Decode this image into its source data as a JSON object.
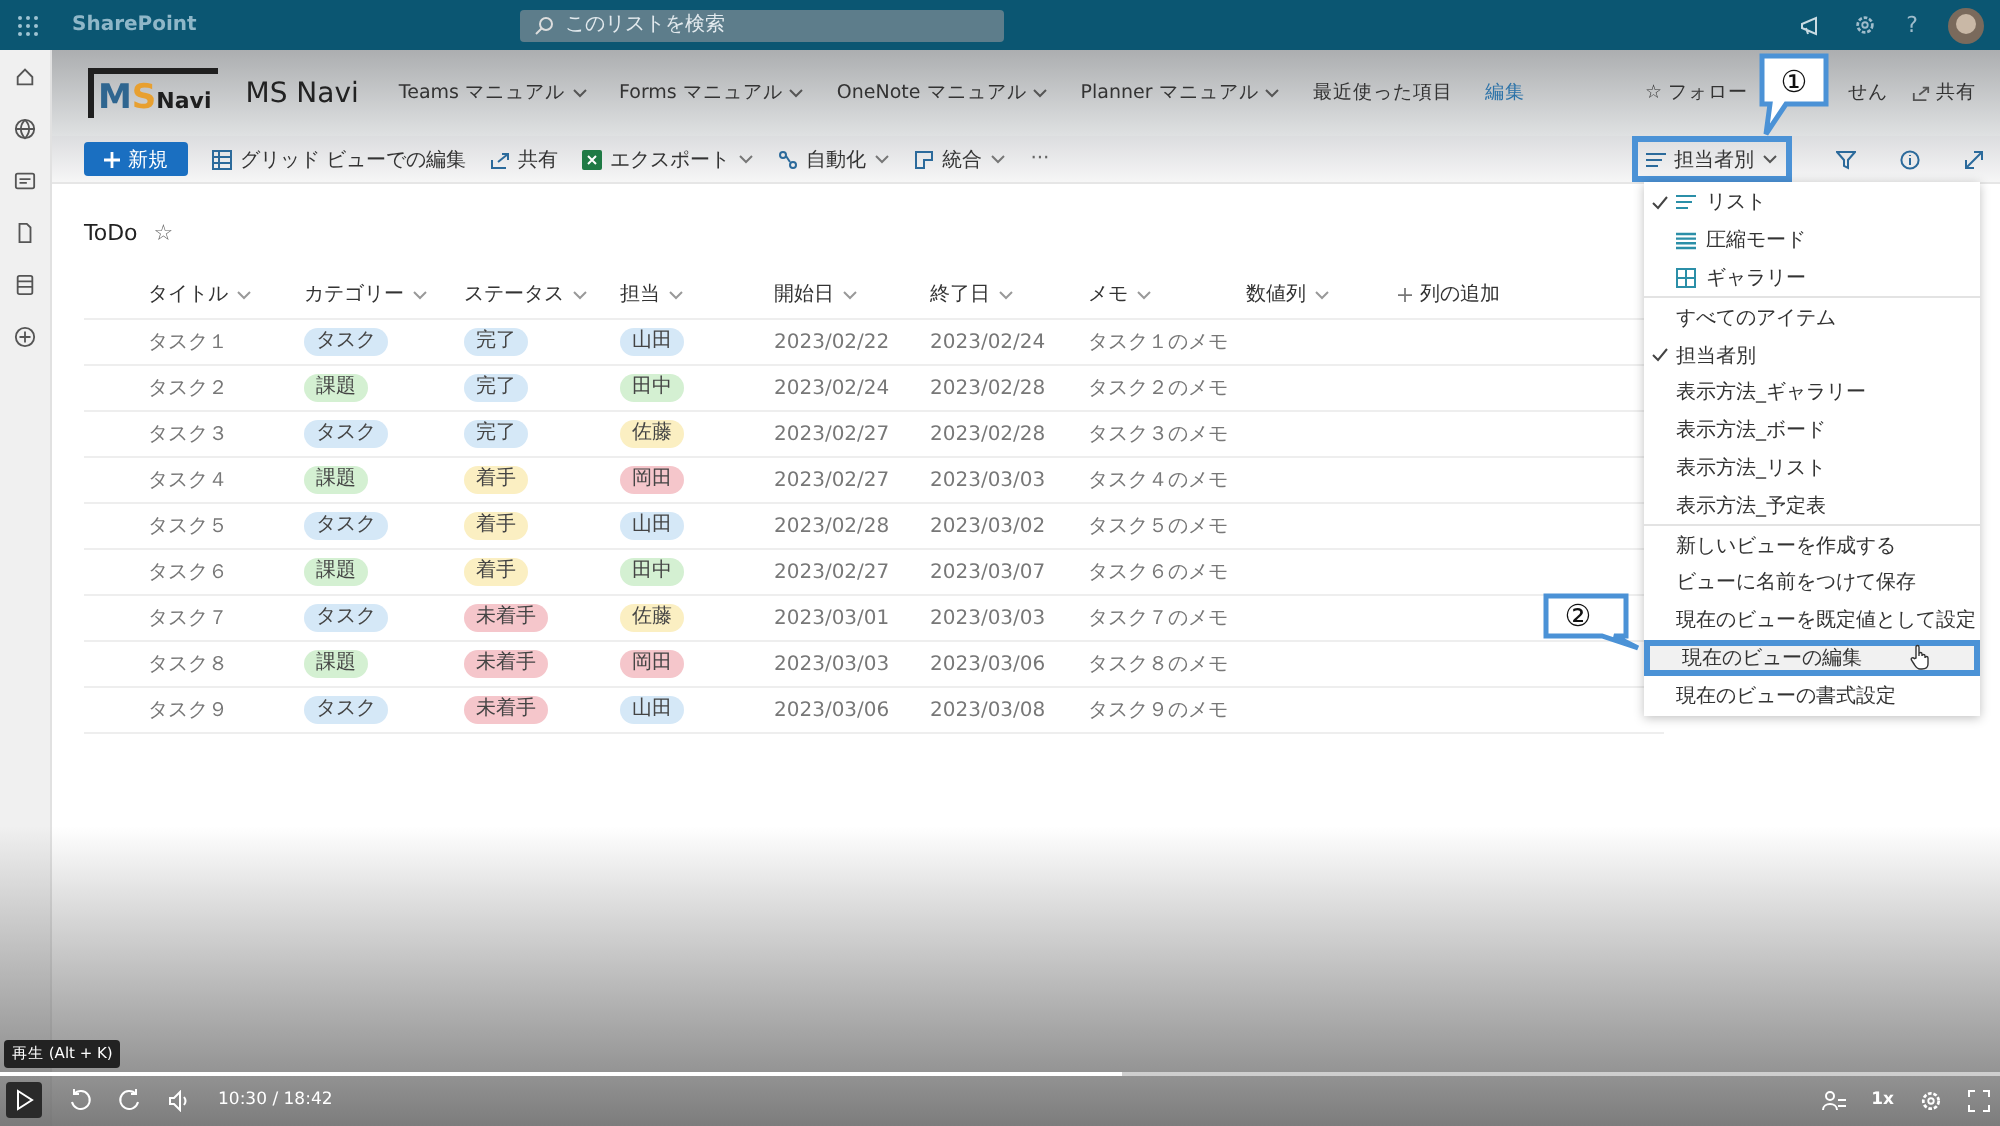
{
  "top_bar": {
    "app_name": "SharePoint",
    "search": {
      "placeholder": "このリストを検索"
    },
    "help": "?"
  },
  "site_header": {
    "logo": [
      {
        "text": "M",
        "color": "#2f6690"
      },
      {
        "text": "S",
        "color": "#e8a030"
      },
      {
        "text": "Navi",
        "color": "#1f1f1f"
      }
    ],
    "site_title": "MS Navi",
    "nav": [
      {
        "label": "Teams マニュアル",
        "kind": "menu"
      },
      {
        "label": "Forms マニュアル",
        "kind": "menu"
      },
      {
        "label": "OneNote マニュアル",
        "kind": "menu"
      },
      {
        "label": "Planner マニュアル",
        "kind": "menu"
      },
      {
        "label": "最近使った項目",
        "kind": "plain"
      },
      {
        "label": "編集",
        "kind": "link"
      }
    ],
    "follow": {
      "star": "☆",
      "before": "フォロー",
      "after": "せん"
    },
    "share": "共有"
  },
  "command_bar": {
    "new": "新規",
    "items": [
      {
        "label": "グリッド ビューでの編集",
        "kind": "grid",
        "dropdown": false
      },
      {
        "label": "共有",
        "kind": "share",
        "dropdown": false
      },
      {
        "label": "エクスポート",
        "kind": "excel",
        "dropdown": true
      },
      {
        "label": "自動化",
        "kind": "automate",
        "dropdown": true
      },
      {
        "label": "統合",
        "kind": "integrate",
        "dropdown": true
      }
    ],
    "more": "···",
    "view": "担当者別"
  },
  "list": {
    "title": "ToDo",
    "star": "☆",
    "columns": [
      {
        "label": "タイトル",
        "kind": "column"
      },
      {
        "label": "カテゴリー",
        "kind": "column"
      },
      {
        "label": "ステータス",
        "kind": "column"
      },
      {
        "label": "担当",
        "kind": "column"
      },
      {
        "label": "開始日",
        "kind": "column"
      },
      {
        "label": "終了日",
        "kind": "column"
      },
      {
        "label": "メモ",
        "kind": "column"
      },
      {
        "label": "数値列",
        "kind": "column"
      },
      {
        "label": "列の追加",
        "kind": "add"
      }
    ],
    "rows": [
      {
        "title": "タスク１",
        "category": {
          "text": "タスク",
          "color": "#d5e8f7"
        },
        "status": {
          "text": "完了",
          "color": "#d5e8f7"
        },
        "owner": {
          "text": "山田",
          "color": "#d5e8f7"
        },
        "start": "2023/02/22",
        "end": "2023/02/24",
        "memo": "タスク１のメモ"
      },
      {
        "title": "タスク２",
        "category": {
          "text": "課題",
          "color": "#d4f0d2"
        },
        "status": {
          "text": "完了",
          "color": "#d5e8f7"
        },
        "owner": {
          "text": "田中",
          "color": "#d4f0d2"
        },
        "start": "2023/02/24",
        "end": "2023/02/28",
        "memo": "タスク２のメモ"
      },
      {
        "title": "タスク３",
        "category": {
          "text": "タスク",
          "color": "#d5e8f7"
        },
        "status": {
          "text": "完了",
          "color": "#d5e8f7"
        },
        "owner": {
          "text": "佐藤",
          "color": "#fbefc2"
        },
        "start": "2023/02/27",
        "end": "2023/02/28",
        "memo": "タスク３のメモ"
      },
      {
        "title": "タスク４",
        "category": {
          "text": "課題",
          "color": "#d4f0d2"
        },
        "status": {
          "text": "着手",
          "color": "#fbefc2"
        },
        "owner": {
          "text": "岡田",
          "color": "#f5c6cb"
        },
        "start": "2023/02/27",
        "end": "2023/03/03",
        "memo": "タスク４のメモ"
      },
      {
        "title": "タスク５",
        "category": {
          "text": "タスク",
          "color": "#d5e8f7"
        },
        "status": {
          "text": "着手",
          "color": "#fbefc2"
        },
        "owner": {
          "text": "山田",
          "color": "#d5e8f7"
        },
        "start": "2023/02/28",
        "end": "2023/03/02",
        "memo": "タスク５のメモ"
      },
      {
        "title": "タスク６",
        "category": {
          "text": "課題",
          "color": "#d4f0d2"
        },
        "status": {
          "text": "着手",
          "color": "#fbefc2"
        },
        "owner": {
          "text": "田中",
          "color": "#d4f0d2"
        },
        "start": "2023/02/27",
        "end": "2023/03/07",
        "memo": "タスク６のメモ"
      },
      {
        "title": "タスク７",
        "category": {
          "text": "タスク",
          "color": "#d5e8f7"
        },
        "status": {
          "text": "未着手",
          "color": "#f5c6cb"
        },
        "owner": {
          "text": "佐藤",
          "color": "#fbefc2"
        },
        "start": "2023/03/01",
        "end": "2023/03/03",
        "memo": "タスク７のメモ"
      },
      {
        "title": "タスク８",
        "category": {
          "text": "課題",
          "color": "#d4f0d2"
        },
        "status": {
          "text": "未着手",
          "color": "#f5c6cb"
        },
        "owner": {
          "text": "岡田",
          "color": "#f5c6cb"
        },
        "start": "2023/03/03",
        "end": "2023/03/06",
        "memo": "タスク８のメモ"
      },
      {
        "title": "タスク９",
        "category": {
          "text": "タスク",
          "color": "#d5e8f7"
        },
        "status": {
          "text": "未着手",
          "color": "#f5c6cb"
        },
        "owner": {
          "text": "山田",
          "color": "#d5e8f7"
        },
        "start": "2023/03/06",
        "end": "2023/03/08",
        "memo": "タスク９のメモ"
      }
    ]
  },
  "view_menu": {
    "groups": [
      [
        {
          "label": "リスト",
          "kind": "list",
          "checked": true
        },
        {
          "label": "圧縮モード",
          "kind": "compact",
          "checked": false
        },
        {
          "label": "ギャラリー",
          "kind": "gallery",
          "checked": false
        }
      ],
      [
        {
          "label": "すべてのアイテム",
          "kind": "view",
          "checked": false
        },
        {
          "label": "担当者別",
          "kind": "view",
          "checked": true
        },
        {
          "label": "表示方法_ギャラリー",
          "kind": "view",
          "checked": false
        },
        {
          "label": "表示方法_ボード",
          "kind": "view",
          "checked": false
        },
        {
          "label": "表示方法_リスト",
          "kind": "view",
          "checked": false
        },
        {
          "label": "表示方法_予定表",
          "kind": "view",
          "checked": false
        }
      ],
      [
        {
          "label": "新しいビューを作成する",
          "kind": "action",
          "hovered": false
        },
        {
          "label": "ビューに名前をつけて保存",
          "kind": "action",
          "hovered": false
        },
        {
          "label": "現在のビューを既定値として設定",
          "kind": "action",
          "hovered": false
        },
        {
          "label": "現在のビューの編集",
          "kind": "action",
          "hovered": true
        },
        {
          "label": "現在のビューの書式設定",
          "kind": "action",
          "hovered": false
        }
      ]
    ]
  },
  "callouts": [
    {
      "number": "①"
    },
    {
      "number": "②"
    }
  ],
  "player": {
    "tooltip": "再生 (Alt + K)",
    "time": "10:30 / 18:42",
    "level": 0.561,
    "speed": "1x"
  }
}
